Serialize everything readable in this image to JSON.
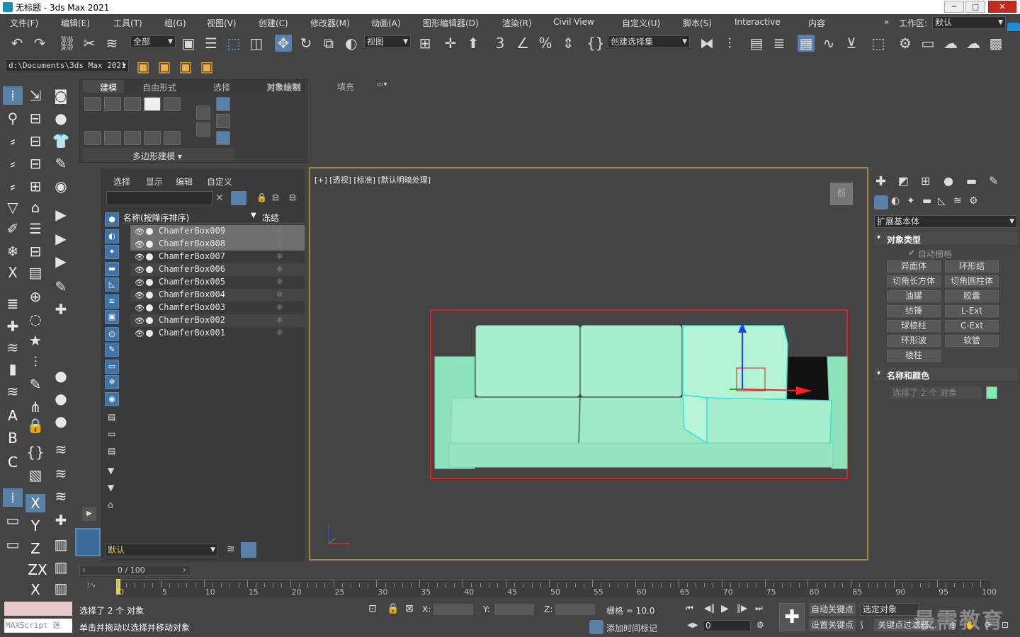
{
  "window": {
    "title": "无标题 - 3ds Max 2021",
    "min": "─",
    "max": "□",
    "close": "✕"
  },
  "menu": [
    "文件(F)",
    "编辑(E)",
    "工具(T)",
    "组(G)",
    "视图(V)",
    "创建(C)",
    "修改器(M)",
    "动画(A)",
    "图形编辑器(D)",
    "渲染(R)",
    "Civil View",
    "自定义(U)",
    "脚本(S)",
    "Interactive",
    "内容"
  ],
  "workspace": {
    "prefix": "»",
    "label": "工作区:",
    "value": "默认"
  },
  "toolbar": {
    "filter": "全部",
    "refcoord": "视图",
    "selset": "创建选择集"
  },
  "project": {
    "path": "d:\\Documents\\3ds Max 2021"
  },
  "ribbon": {
    "tabs": [
      "建模",
      "自由形式",
      "选择",
      "对象绘制",
      "填充"
    ],
    "active": "建模",
    "footer": "多边形建模 ▾"
  },
  "explorer": {
    "menu": [
      "选择",
      "显示",
      "编辑",
      "自定义"
    ],
    "col_name": "名称(按降序排序)",
    "col_freeze": "冻结",
    "rows": [
      "ChamferBox009",
      "ChamferBox008",
      "ChamferBox007",
      "ChamferBox006",
      "ChamferBox005",
      "ChamferBox004",
      "ChamferBox003",
      "ChamferBox002",
      "ChamferBox001"
    ],
    "selected_count": 2,
    "layer": "默认"
  },
  "viewport": {
    "label": "[+] [透视] [标准] [默认明暗处理]",
    "cube": "前"
  },
  "command_panel": {
    "category": "扩展基本体",
    "rollout_object_type": "对象类型",
    "autogrid": "自动栅格",
    "buttons": [
      "异面体",
      "环形结",
      "切角长方体",
      "切角圆柱体",
      "油罐",
      "胶囊",
      "纺锤",
      "L-Ext",
      "球棱柱",
      "C-Ext",
      "环形波",
      "软管",
      "棱柱"
    ],
    "rollout_name_color": "名称和颜色",
    "name_field": "选择了 2 个 对象",
    "swatch_color": "#7cf0b0"
  },
  "timeline": {
    "frame": "0 / 100",
    "ticks": [
      "0",
      "5",
      "10",
      "15",
      "20",
      "25",
      "30",
      "35",
      "40",
      "45",
      "50",
      "55",
      "60",
      "65",
      "70",
      "75",
      "80",
      "85",
      "90",
      "95",
      "100"
    ]
  },
  "status": {
    "line1": "选择了 2 个 对象",
    "line2": "单击并拖动以选择并移动对象",
    "maxscript": "MAXScript 迷",
    "x": "X:",
    "y": "Y:",
    "z": "Z:",
    "grid": "栅格 = 10.0",
    "add_time_tag": "添加时间标记",
    "autokey": "自动关键点",
    "setkey": "设置关键点",
    "selected_obj": "选定对象",
    "key_filter": "关键点过滤器...",
    "frame_spinner": "0",
    "watermark": "最需教育"
  }
}
